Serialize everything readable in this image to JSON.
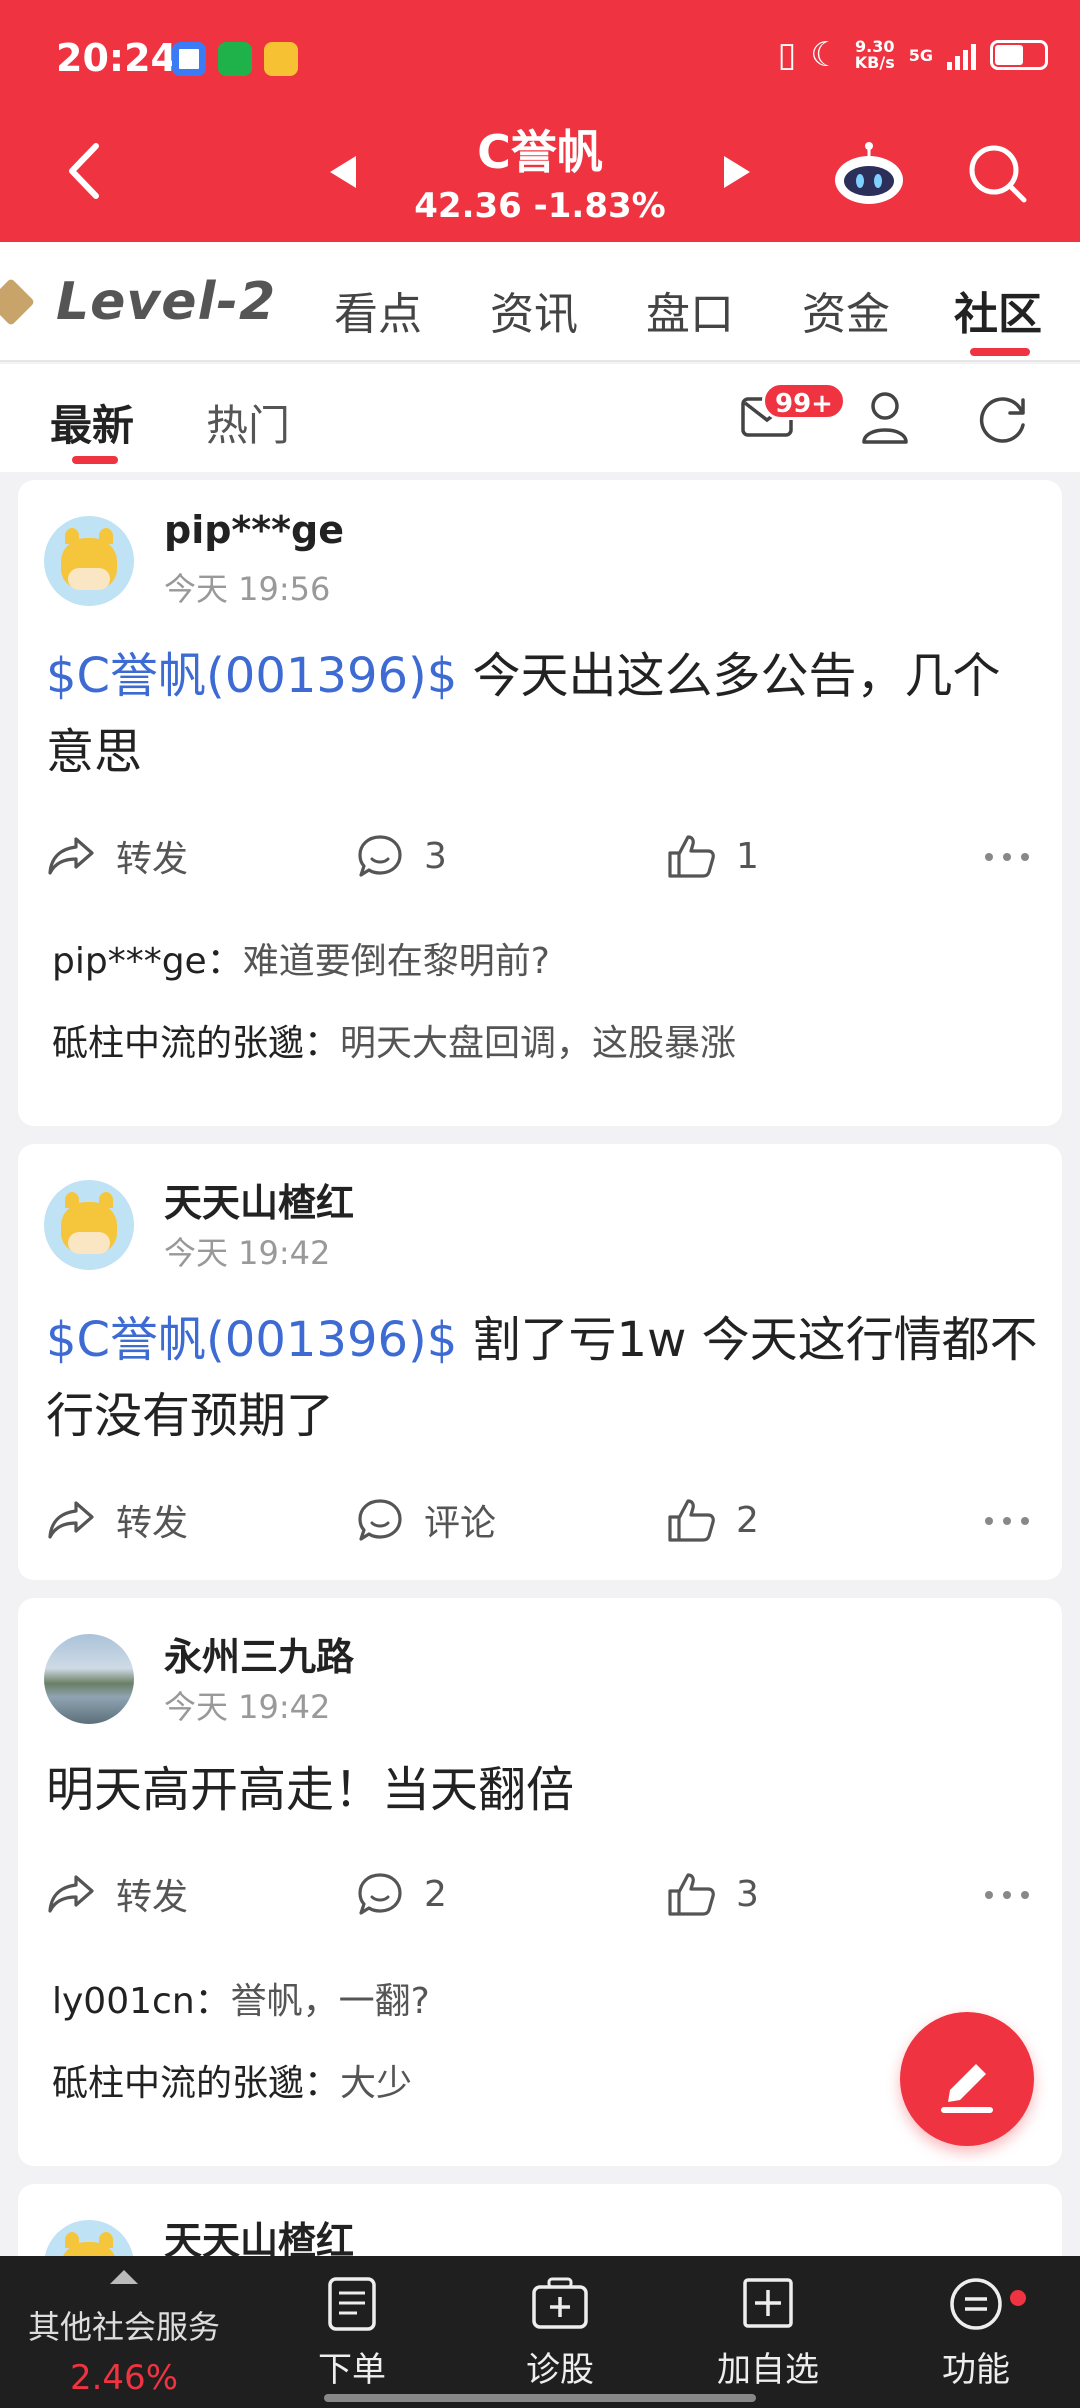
{
  "status_bar": {
    "time": "20:24",
    "net_speed_value": "9.30",
    "net_speed_unit": "KB/s",
    "network_type": "5G"
  },
  "header": {
    "stock_name": "C誉帆",
    "stock_quote": "42.36 -1.83%",
    "accent_color": "#ef3340"
  },
  "tabs": {
    "level2": "Level-2",
    "items": [
      "看点",
      "资讯",
      "盘口",
      "资金",
      "社区"
    ],
    "active": "社区"
  },
  "subtabs": {
    "items": [
      "最新",
      "热门"
    ],
    "active": "最新",
    "mail_badge": "99+"
  },
  "posts": [
    {
      "username": "pip***ge",
      "time": "今天 19:56",
      "stock_tag": "$C誉帆(001396)$",
      "text": " 今天出这么多公告，几个意思",
      "share_label": "转发",
      "comment_count": "3",
      "like_count": "1",
      "comments": [
        {
          "name": "pip***ge：",
          "text": "难道要倒在黎明前?"
        },
        {
          "name": "砥柱中流的张邈：",
          "text": "明天大盘回调，这股暴涨"
        }
      ]
    },
    {
      "username": "天天山楂红",
      "time": "今天 19:42",
      "stock_tag": "$C誉帆(001396)$",
      "text": " 割了亏1w 今天这行情都不行没有预期了",
      "share_label": "转发",
      "comment_count": "评论",
      "like_count": "2",
      "comments": []
    },
    {
      "username": "永州三九路",
      "time": "今天 19:42",
      "stock_tag": "",
      "text": "明天高开高走！当天翻倍",
      "share_label": "转发",
      "comment_count": "2",
      "like_count": "3",
      "comments": [
        {
          "name": "ly001cn：",
          "text": "誉帆，一翻?"
        },
        {
          "name": "砥柱中流的张邈：",
          "text": "大少"
        }
      ]
    },
    {
      "username": "天天山楂红"
    }
  ],
  "bottom_bar": {
    "other_service": "其他社会服务",
    "other_service_pct": "2.46%",
    "items": [
      "下单",
      "诊股",
      "加自选",
      "功能"
    ]
  }
}
